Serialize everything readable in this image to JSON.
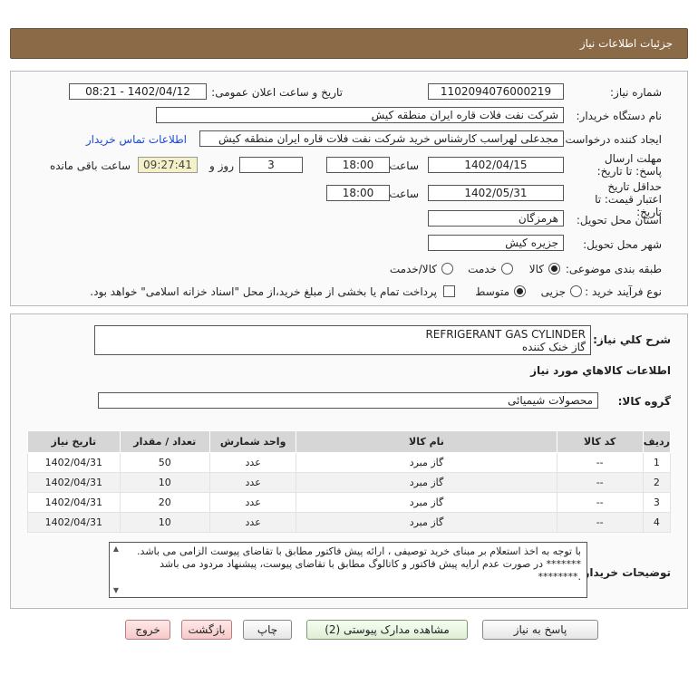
{
  "header": {
    "title": "جزئیات اطلاعات نیاز"
  },
  "form": {
    "need_number": {
      "label": "شماره نیاز:",
      "value": "1102094076000219"
    },
    "announce": {
      "label": "تاریخ و ساعت اعلان عمومی:",
      "value": "1402/04/12 - 08:21"
    },
    "buyer_org": {
      "label": "نام دستگاه خریدار:",
      "value": "شرکت نفت فلات قاره ایران منطقه کیش"
    },
    "creator": {
      "label": "ایجاد کننده درخواست:",
      "value": "مجدعلی لهراسب کارشناس خرید شرکت نفت فلات قاره ایران منطقه کیش"
    },
    "contact_link": "اطلاعات تماس خریدار",
    "reply_deadline": {
      "label": "مهلت ارسال پاسخ: تا تاریخ:",
      "date": "1402/04/15",
      "time_label": "ساعت",
      "time": "18:00",
      "days": "3",
      "days_label": "روز و",
      "remaining": "09:27:41",
      "remaining_label": "ساعت باقی مانده"
    },
    "price_validity": {
      "label": "حداقل تاریخ اعتبار قیمت: تا تاریخ:",
      "date": "1402/05/31",
      "time_label": "ساعت",
      "time": "18:00"
    },
    "province": {
      "label": "استان محل تحویل:",
      "value": "هرمزگان"
    },
    "city": {
      "label": "شهر محل تحویل:",
      "value": "جزیره کیش"
    },
    "category": {
      "label": "طبقه بندی موضوعی:",
      "options": [
        "کالا",
        "خدمت",
        "کالا/خدمت"
      ],
      "selected": "کالا"
    },
    "process": {
      "label": "نوع فرآیند خرید :",
      "options": [
        "جزیی",
        "متوسط"
      ],
      "selected": "متوسط",
      "payment_note": "پرداخت تمام یا بخشی از مبلغ خرید،از محل \"اسناد خزانه اسلامی\" خواهد بود."
    }
  },
  "details": {
    "summary_label": "شرح کلي نياز:",
    "summary_line1": "REFRIGERANT GAS CYLINDER",
    "summary_line2": "گاز خنک کننده",
    "goods_info_title": "اطلاعات کالاهاي مورد نياز",
    "group_label": "گروه کالا:",
    "group_value": "محصولات شیمیائی",
    "table": {
      "columns": [
        "ردیف",
        "کد کالا",
        "نام کالا",
        "واحد شمارش",
        "تعداد / مقدار",
        "تاریخ نیاز"
      ],
      "rows": [
        [
          "1",
          "--",
          "گاز مبرد",
          "عدد",
          "50",
          "1402/04/31"
        ],
        [
          "2",
          "--",
          "گاز مبرد",
          "عدد",
          "10",
          "1402/04/31"
        ],
        [
          "3",
          "--",
          "گاز مبرد",
          "عدد",
          "20",
          "1402/04/31"
        ],
        [
          "4",
          "--",
          "گاز مبرد",
          "عدد",
          "10",
          "1402/04/31"
        ]
      ]
    },
    "notes_label": "توضیحات خریدار:",
    "notes_line1": "با توجه به اخذ استعلام بر مبنای خرید توصیفی ، ارائه پیش فاکتور مطابق با تقاضای پیوست الزامی می باشد.",
    "notes_line2": "******* در صورت عدم ارایه پیش فاکتور و کاتالوگ مطابق با تقاضای پیوست، پیشنهاد مردود می باشد .********"
  },
  "buttons": {
    "reply": "پاسخ به نیاز",
    "attachments": "مشاهده مدارک پیوستی (2)",
    "print": "چاپ",
    "back": "بازگشت",
    "exit": "خروج"
  }
}
